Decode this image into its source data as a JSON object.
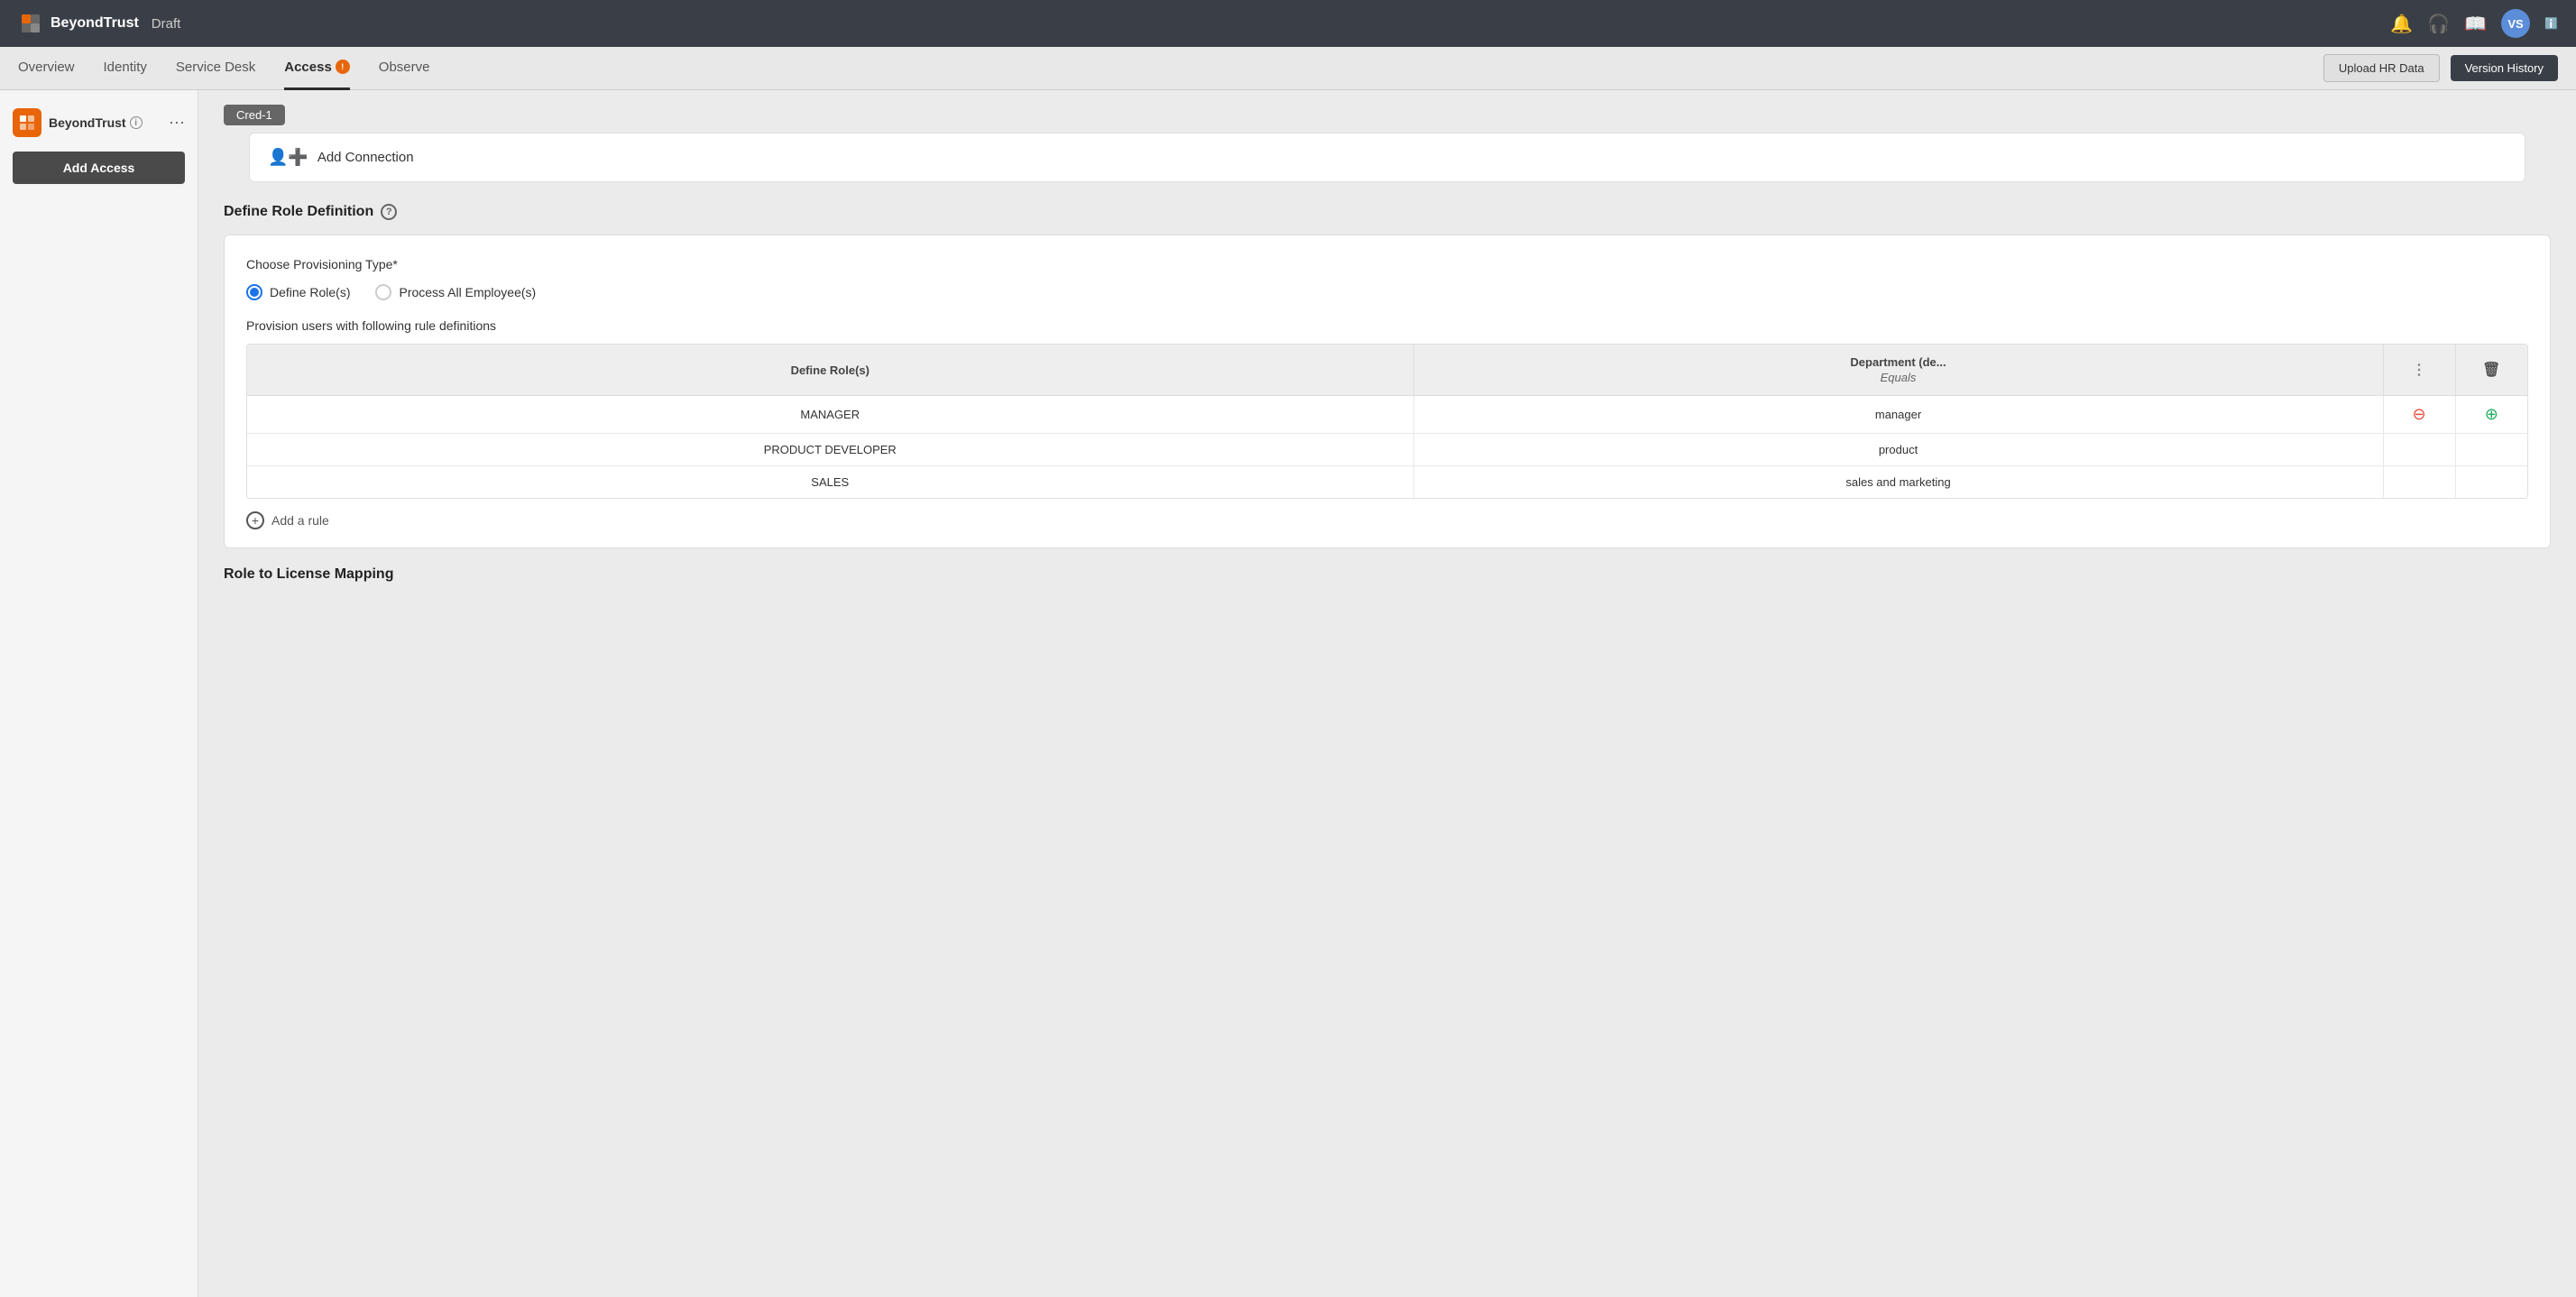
{
  "topbar": {
    "logo_text": "BeyondTrust",
    "draft_label": "Draft",
    "avatar_initials": "VS",
    "notification_icon": "🔔",
    "headset_icon": "🎧",
    "book_icon": "📖"
  },
  "secnav": {
    "tabs": [
      {
        "label": "Overview",
        "active": false
      },
      {
        "label": "Identity",
        "active": false
      },
      {
        "label": "Service Desk",
        "active": false
      },
      {
        "label": "Access",
        "active": true,
        "badge": "!"
      },
      {
        "label": "Observe",
        "active": false
      }
    ],
    "upload_hr_label": "Upload HR Data",
    "version_history_label": "Version History"
  },
  "sidebar": {
    "brand_name": "BeyondTrust",
    "add_access_label": "Add Access"
  },
  "content": {
    "cred_tag": "Cred-1",
    "add_connection_label": "Add Connection",
    "define_role_section_title": "Define Role Definition",
    "provisioning": {
      "label": "Choose Provisioning Type*",
      "options": [
        {
          "label": "Define Role(s)",
          "selected": true
        },
        {
          "label": "Process All Employee(s)",
          "selected": false
        }
      ]
    },
    "provision_users_label": "Provision users with following rule definitions",
    "table": {
      "col1_header": "Define Role(s)",
      "col2_header": "Department (de...",
      "col2_subheader": "Equals",
      "rows": [
        {
          "role": "MANAGER",
          "department": "manager"
        },
        {
          "role": "PRODUCT DEVELOPER",
          "department": "product"
        },
        {
          "role": "SALES",
          "department": "sales and marketing"
        }
      ]
    },
    "add_rule_label": "Add a rule",
    "role_license_label": "Role to License Mapping"
  }
}
